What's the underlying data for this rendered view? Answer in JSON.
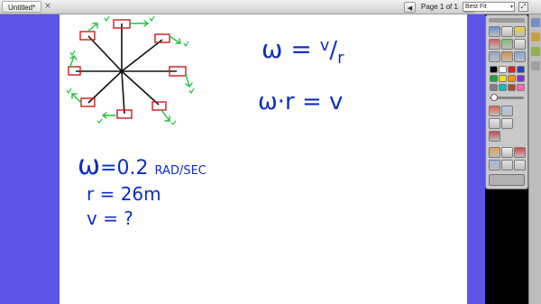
{
  "document": {
    "tab_title": "Untitled*",
    "close_glyph": "×"
  },
  "pager": {
    "prev_glyph": "◀",
    "next_glyph": "▶",
    "label": "Page 1 of 1",
    "zoom": "Best Fit",
    "zoom_caret": "▾",
    "fullscreen_glyph": "⤢"
  },
  "colors": {
    "margin": "#5c54e6",
    "canvas": "#ffffff",
    "ink_blue": "#0d2fbf",
    "ink_green": "#1fc23a",
    "ink_red": "#d11a1a",
    "ink_black": "#111111"
  },
  "ink": {
    "omega_eq_a": "ω = ",
    "v_sym": "v",
    "slash": "/",
    "r_sym": "r",
    "omega_eq_b": "ω·r = v",
    "given_omega_sym": "ω",
    "given_omega_val": "=0.2 ",
    "given_omega_unit": "RAD/SEC",
    "given_r": "r = 26m",
    "given_v": "v = ?"
  },
  "diagram": {
    "spokes": 8,
    "label": "rotating wheel with velocity vectors"
  },
  "toolbar": {
    "icons": [
      "select-icon",
      "pen-icon",
      "highlighter-icon",
      "eraser-icon",
      "shape-icon",
      "text-icon",
      "line-icon",
      "fill-icon",
      "screen-icon",
      "capture-icon",
      "table-icon",
      "undo-icon",
      "redo-icon",
      "delete-icon"
    ],
    "palette": [
      "#000000",
      "#ffffff",
      "#e02020",
      "#1f3fd0",
      "#20a040",
      "#f0e020",
      "#ff8c00",
      "#8a2be2",
      "#808080",
      "#00c0c0",
      "#a0522d",
      "#ff69b4"
    ]
  }
}
